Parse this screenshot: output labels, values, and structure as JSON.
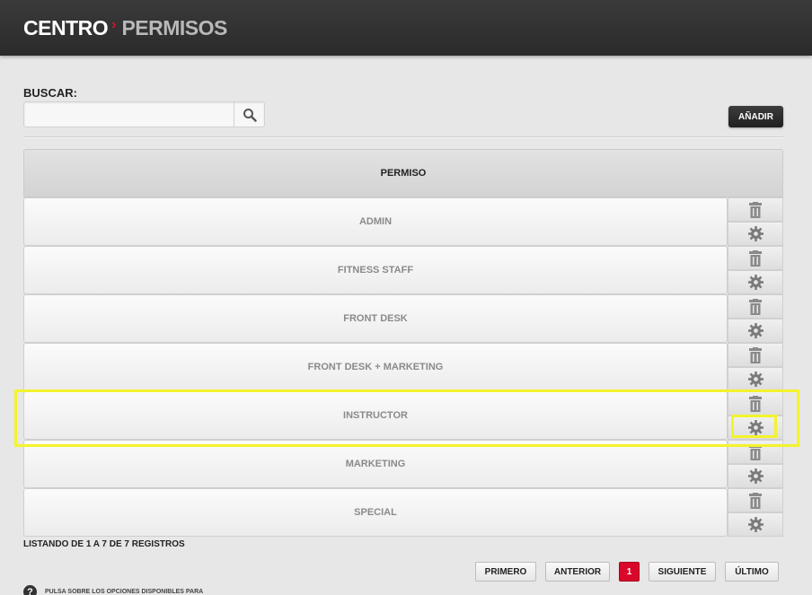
{
  "header": {
    "crumb1": "CENTRO",
    "crumb2": "PERMISOS"
  },
  "search": {
    "label": "BUSCAR:",
    "value": "",
    "placeholder": ""
  },
  "toolbar": {
    "add_label": "AÑADIR"
  },
  "table": {
    "column_header": "PERMISO",
    "rows": [
      {
        "name": "ADMIN"
      },
      {
        "name": "FITNESS STAFF"
      },
      {
        "name": "FRONT DESK"
      },
      {
        "name": "FRONT DESK + MARKETING"
      },
      {
        "name": "INSTRUCTOR"
      },
      {
        "name": "MARKETING"
      },
      {
        "name": "SPECIAL"
      }
    ]
  },
  "listing": {
    "text": "LISTANDO DE 1 A 7 DE 7 REGISTROS"
  },
  "pagination": {
    "first": "PRIMERO",
    "prev": "ANTERIOR",
    "current": "1",
    "next": "SIGUIENTE",
    "last": "ÚLTIMO"
  },
  "help": {
    "text": "PULSA SOBRE LOS OPCIONES DISPONIBLES PARA"
  },
  "colors": {
    "accent": "#d9082a",
    "header_bg": "#2f2f2f",
    "highlight": "#f3f32c"
  },
  "icons": {
    "search": "search-icon",
    "delete": "trash-icon",
    "settings": "gear-icon",
    "help": "question-icon"
  }
}
